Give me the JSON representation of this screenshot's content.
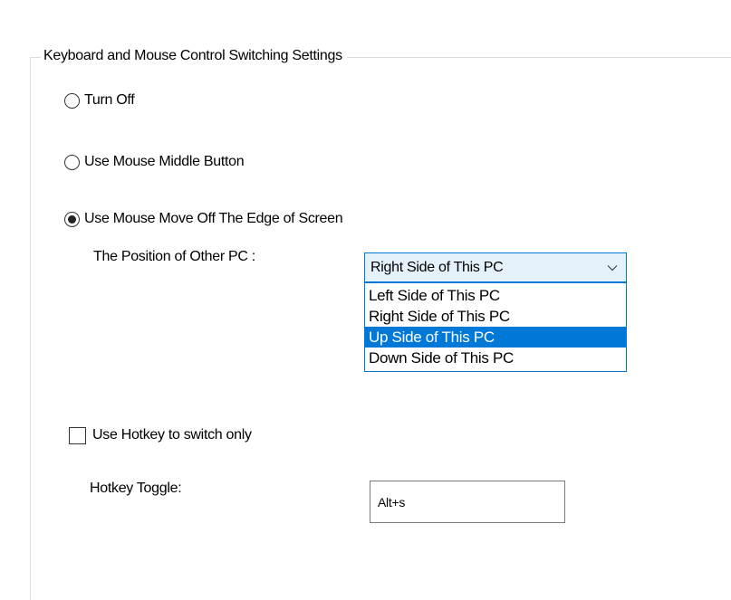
{
  "group": {
    "title": "Keyboard and Mouse Control Switching Settings"
  },
  "switch_modes": {
    "options": [
      {
        "label": "Turn Off",
        "checked": false
      },
      {
        "label": "Use Mouse Middle Button",
        "checked": false
      },
      {
        "label": "Use Mouse Move Off The Edge of Screen",
        "checked": true
      }
    ]
  },
  "position": {
    "label": "The Position of Other PC :",
    "selected": "Right Side of This PC",
    "options": [
      {
        "label": "Left Side of This PC",
        "highlighted": false
      },
      {
        "label": "Right Side of This PC",
        "highlighted": false
      },
      {
        "label": "Up Side of This PC",
        "highlighted": true
      },
      {
        "label": "Down Side of This PC",
        "highlighted": false
      }
    ]
  },
  "hotkey": {
    "checkbox_label": "Use Hotkey to switch only",
    "checked": false,
    "toggle_label": "Hotkey Toggle:",
    "toggle_value": "Alt+s"
  },
  "colors": {
    "accent": "#0078d7",
    "combo_background": "#e5f1fb",
    "group_border": "#dcdcdc"
  },
  "icons": {
    "combo_arrow": "chevron-down-icon"
  }
}
